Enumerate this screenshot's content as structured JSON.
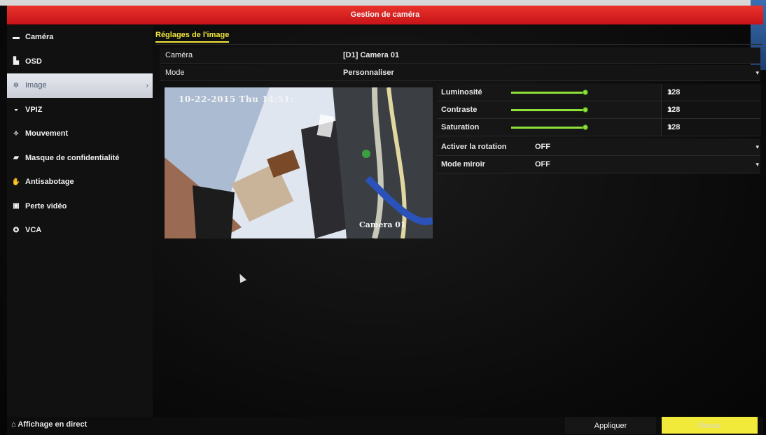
{
  "window": {
    "title": "Gestion de caméra"
  },
  "sidebar": {
    "items": [
      {
        "label": "Caméra",
        "icon": "camera-icon"
      },
      {
        "label": "OSD",
        "icon": "osd-icon"
      },
      {
        "label": "Image",
        "icon": "image-icon",
        "active": true
      },
      {
        "label": "VPIZ",
        "icon": "ptz-icon"
      },
      {
        "label": "Mouvement",
        "icon": "motion-icon"
      },
      {
        "label": "Masque de confidentialité",
        "icon": "privacy-mask-icon"
      },
      {
        "label": "Antisabotage",
        "icon": "tamper-icon"
      },
      {
        "label": "Perte vidéo",
        "icon": "video-loss-icon"
      },
      {
        "label": "VCA",
        "icon": "vca-icon"
      }
    ]
  },
  "tab": {
    "label": "Réglages de l'image"
  },
  "settings": {
    "camera_label": "Caméra",
    "camera_value": "[D1] Camera 01",
    "mode_label": "Mode",
    "mode_value": "Personnaliser"
  },
  "preview": {
    "osd_datetime": "10-22-2015 Thu 14:51:",
    "osd_camera": "Camera 01"
  },
  "image_props": [
    {
      "label": "Luminosité",
      "value": "128",
      "level": 0.5
    },
    {
      "label": "Contraste",
      "value": "128",
      "level": 0.5
    },
    {
      "label": "Saturation",
      "value": "128",
      "level": 0.5
    }
  ],
  "options": {
    "rotation_label": "Activer la rotation",
    "rotation_value": "OFF",
    "mirror_label": "Mode miroir",
    "mirror_value": "OFF"
  },
  "footer": {
    "live_label": "Affichage en direct",
    "apply_label": "Appliquer",
    "back_label": "Retour"
  },
  "colors": {
    "titlebar": "#d81e20",
    "accent": "#f2e63a",
    "slider": "#8ee03a"
  }
}
